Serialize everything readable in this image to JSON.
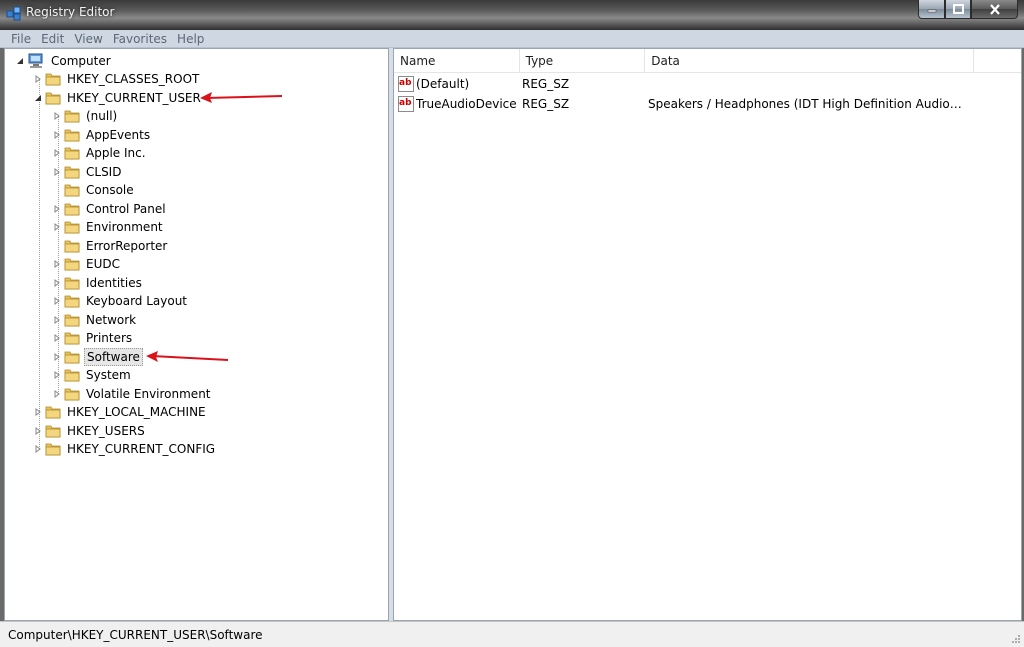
{
  "window": {
    "title": "Registry Editor",
    "icon": "registry-editor-icon"
  },
  "menu": [
    "File",
    "Edit",
    "View",
    "Favorites",
    "Help"
  ],
  "tree": {
    "root": "Computer",
    "hives": [
      "HKEY_CLASSES_ROOT",
      "HKEY_CURRENT_USER",
      "HKEY_LOCAL_MACHINE",
      "HKEY_USERS",
      "HKEY_CURRENT_CONFIG"
    ],
    "hkcu_children": [
      "(null)",
      "AppEvents",
      "Apple Inc.",
      "CLSID",
      "Console",
      "Control Panel",
      "Environment",
      "ErrorReporter",
      "EUDC",
      "Identities",
      "Keyboard Layout",
      "Network",
      "Printers",
      "Software",
      "System",
      "Volatile Environment"
    ],
    "selected": "Software"
  },
  "list": {
    "columns": [
      "Name",
      "Type",
      "Data"
    ],
    "rows": [
      {
        "name": "(Default)",
        "type": "REG_SZ",
        "data": ""
      },
      {
        "name": "TrueAudioDevice",
        "type": "REG_SZ",
        "data": "Speakers / Headphones (IDT High Definition Audio…"
      }
    ]
  },
  "status": {
    "path": "Computer\\HKEY_CURRENT_USER\\Software"
  },
  "colors": {
    "annotation_arrow": "#d9121b",
    "folder": "#e8c25a"
  }
}
